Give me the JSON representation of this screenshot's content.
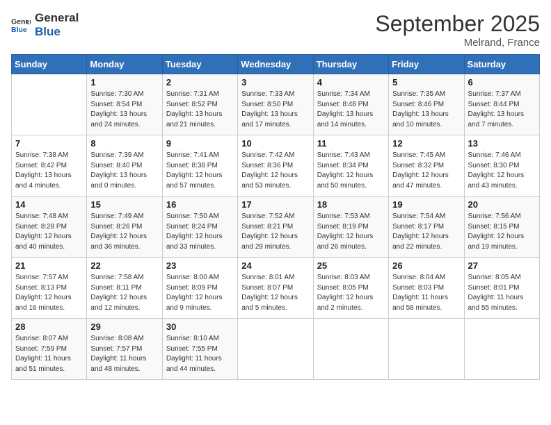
{
  "header": {
    "logo_line1": "General",
    "logo_line2": "Blue",
    "month": "September 2025",
    "location": "Melrand, France"
  },
  "weekdays": [
    "Sunday",
    "Monday",
    "Tuesday",
    "Wednesday",
    "Thursday",
    "Friday",
    "Saturday"
  ],
  "weeks": [
    [
      {
        "day": "",
        "sunrise": "",
        "sunset": "",
        "daylight": ""
      },
      {
        "day": "1",
        "sunrise": "Sunrise: 7:30 AM",
        "sunset": "Sunset: 8:54 PM",
        "daylight": "Daylight: 13 hours and 24 minutes."
      },
      {
        "day": "2",
        "sunrise": "Sunrise: 7:31 AM",
        "sunset": "Sunset: 8:52 PM",
        "daylight": "Daylight: 13 hours and 21 minutes."
      },
      {
        "day": "3",
        "sunrise": "Sunrise: 7:33 AM",
        "sunset": "Sunset: 8:50 PM",
        "daylight": "Daylight: 13 hours and 17 minutes."
      },
      {
        "day": "4",
        "sunrise": "Sunrise: 7:34 AM",
        "sunset": "Sunset: 8:48 PM",
        "daylight": "Daylight: 13 hours and 14 minutes."
      },
      {
        "day": "5",
        "sunrise": "Sunrise: 7:35 AM",
        "sunset": "Sunset: 8:46 PM",
        "daylight": "Daylight: 13 hours and 10 minutes."
      },
      {
        "day": "6",
        "sunrise": "Sunrise: 7:37 AM",
        "sunset": "Sunset: 8:44 PM",
        "daylight": "Daylight: 13 hours and 7 minutes."
      }
    ],
    [
      {
        "day": "7",
        "sunrise": "Sunrise: 7:38 AM",
        "sunset": "Sunset: 8:42 PM",
        "daylight": "Daylight: 13 hours and 4 minutes."
      },
      {
        "day": "8",
        "sunrise": "Sunrise: 7:39 AM",
        "sunset": "Sunset: 8:40 PM",
        "daylight": "Daylight: 13 hours and 0 minutes."
      },
      {
        "day": "9",
        "sunrise": "Sunrise: 7:41 AM",
        "sunset": "Sunset: 8:38 PM",
        "daylight": "Daylight: 12 hours and 57 minutes."
      },
      {
        "day": "10",
        "sunrise": "Sunrise: 7:42 AM",
        "sunset": "Sunset: 8:36 PM",
        "daylight": "Daylight: 12 hours and 53 minutes."
      },
      {
        "day": "11",
        "sunrise": "Sunrise: 7:43 AM",
        "sunset": "Sunset: 8:34 PM",
        "daylight": "Daylight: 12 hours and 50 minutes."
      },
      {
        "day": "12",
        "sunrise": "Sunrise: 7:45 AM",
        "sunset": "Sunset: 8:32 PM",
        "daylight": "Daylight: 12 hours and 47 minutes."
      },
      {
        "day": "13",
        "sunrise": "Sunrise: 7:46 AM",
        "sunset": "Sunset: 8:30 PM",
        "daylight": "Daylight: 12 hours and 43 minutes."
      }
    ],
    [
      {
        "day": "14",
        "sunrise": "Sunrise: 7:48 AM",
        "sunset": "Sunset: 8:28 PM",
        "daylight": "Daylight: 12 hours and 40 minutes."
      },
      {
        "day": "15",
        "sunrise": "Sunrise: 7:49 AM",
        "sunset": "Sunset: 8:26 PM",
        "daylight": "Daylight: 12 hours and 36 minutes."
      },
      {
        "day": "16",
        "sunrise": "Sunrise: 7:50 AM",
        "sunset": "Sunset: 8:24 PM",
        "daylight": "Daylight: 12 hours and 33 minutes."
      },
      {
        "day": "17",
        "sunrise": "Sunrise: 7:52 AM",
        "sunset": "Sunset: 8:21 PM",
        "daylight": "Daylight: 12 hours and 29 minutes."
      },
      {
        "day": "18",
        "sunrise": "Sunrise: 7:53 AM",
        "sunset": "Sunset: 8:19 PM",
        "daylight": "Daylight: 12 hours and 26 minutes."
      },
      {
        "day": "19",
        "sunrise": "Sunrise: 7:54 AM",
        "sunset": "Sunset: 8:17 PM",
        "daylight": "Daylight: 12 hours and 22 minutes."
      },
      {
        "day": "20",
        "sunrise": "Sunrise: 7:56 AM",
        "sunset": "Sunset: 8:15 PM",
        "daylight": "Daylight: 12 hours and 19 minutes."
      }
    ],
    [
      {
        "day": "21",
        "sunrise": "Sunrise: 7:57 AM",
        "sunset": "Sunset: 8:13 PM",
        "daylight": "Daylight: 12 hours and 16 minutes."
      },
      {
        "day": "22",
        "sunrise": "Sunrise: 7:58 AM",
        "sunset": "Sunset: 8:11 PM",
        "daylight": "Daylight: 12 hours and 12 minutes."
      },
      {
        "day": "23",
        "sunrise": "Sunrise: 8:00 AM",
        "sunset": "Sunset: 8:09 PM",
        "daylight": "Daylight: 12 hours and 9 minutes."
      },
      {
        "day": "24",
        "sunrise": "Sunrise: 8:01 AM",
        "sunset": "Sunset: 8:07 PM",
        "daylight": "Daylight: 12 hours and 5 minutes."
      },
      {
        "day": "25",
        "sunrise": "Sunrise: 8:03 AM",
        "sunset": "Sunset: 8:05 PM",
        "daylight": "Daylight: 12 hours and 2 minutes."
      },
      {
        "day": "26",
        "sunrise": "Sunrise: 8:04 AM",
        "sunset": "Sunset: 8:03 PM",
        "daylight": "Daylight: 11 hours and 58 minutes."
      },
      {
        "day": "27",
        "sunrise": "Sunrise: 8:05 AM",
        "sunset": "Sunset: 8:01 PM",
        "daylight": "Daylight: 11 hours and 55 minutes."
      }
    ],
    [
      {
        "day": "28",
        "sunrise": "Sunrise: 8:07 AM",
        "sunset": "Sunset: 7:59 PM",
        "daylight": "Daylight: 11 hours and 51 minutes."
      },
      {
        "day": "29",
        "sunrise": "Sunrise: 8:08 AM",
        "sunset": "Sunset: 7:57 PM",
        "daylight": "Daylight: 11 hours and 48 minutes."
      },
      {
        "day": "30",
        "sunrise": "Sunrise: 8:10 AM",
        "sunset": "Sunset: 7:55 PM",
        "daylight": "Daylight: 11 hours and 44 minutes."
      },
      {
        "day": "",
        "sunrise": "",
        "sunset": "",
        "daylight": ""
      },
      {
        "day": "",
        "sunrise": "",
        "sunset": "",
        "daylight": ""
      },
      {
        "day": "",
        "sunrise": "",
        "sunset": "",
        "daylight": ""
      },
      {
        "day": "",
        "sunrise": "",
        "sunset": "",
        "daylight": ""
      }
    ]
  ]
}
